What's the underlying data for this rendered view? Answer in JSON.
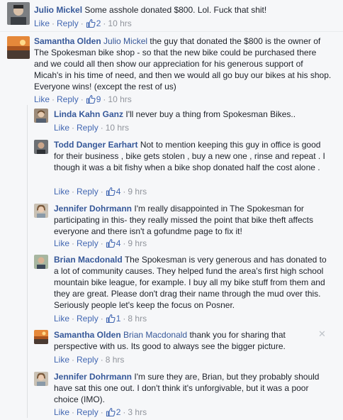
{
  "comments": [
    {
      "author": "Julio Mickel",
      "mention": "",
      "text": "Some asshole donated $800. Lol. Fuck that shit!",
      "like_label": "Like",
      "reply_label": "Reply",
      "likes": "2",
      "time": "10 hrs"
    },
    {
      "author": "Samantha Olden",
      "mention": "Julio Mickel",
      "text": "the guy that donated the $800 is the owner of The Spokesman bike shop - so that the new bike could be purchased there and we could all then show our appreciation for his generous support of Micah's in his time of need, and then we would all go buy our bikes at his shop. Everyone wins! (except the rest of us)",
      "like_label": "Like",
      "reply_label": "Reply",
      "likes": "9",
      "time": "10 hrs"
    },
    {
      "author": "Linda Kahn Ganz",
      "mention": "",
      "text": "I'll never buy a thing from Spokesman Bikes..",
      "like_label": "Like",
      "reply_label": "Reply",
      "likes": "",
      "time": "10 hrs"
    },
    {
      "author": "Todd Danger Earhart",
      "mention": "",
      "text": "Not to mention keeping this guy in office is good for their business , bike gets stolen , buy a new one , rinse and repeat . I though it was a bit fishy when a bike shop donated half the cost alone .",
      "like_label": "Like",
      "reply_label": "Reply",
      "likes": "4",
      "time": "9 hrs"
    },
    {
      "author": "Jennifer Dohrmann",
      "mention": "",
      "text": "I'm really disappointed in The Spokesman for participating in this- they really missed the point that bike theft affects everyone and there isn't a gofundme page to fix it!",
      "like_label": "Like",
      "reply_label": "Reply",
      "likes": "4",
      "time": "9 hrs"
    },
    {
      "author": "Brian Macdonald",
      "mention": "",
      "text": "The Spokesman is very generous and has donated to a lot of community causes. They helped fund the area's first high school mountain bike league, for example. I buy all my bike stuff from them and they are great. Please don't drag their name through the mud over this. Seriously people let's keep the focus on Posner.",
      "like_label": "Like",
      "reply_label": "Reply",
      "likes": "1",
      "time": "8 hrs"
    },
    {
      "author": "Samantha Olden",
      "mention": "Brian Macdonald",
      "text": "thank you for sharing that perspective with us. Its good to always see the bigger picture.",
      "like_label": "Like",
      "reply_label": "Reply",
      "likes": "",
      "time": "8 hrs"
    },
    {
      "author": "Jennifer Dohrmann",
      "mention": "",
      "text": "I'm sure they are, Brian, but they probably should have sat this one out. I don't think it's unforgivable, but it was a poor choice (IMO).",
      "like_label": "Like",
      "reply_label": "Reply",
      "likes": "2",
      "time": "3 hrs"
    }
  ],
  "colors": {
    "link": "#365899",
    "action": "#4267b2",
    "meta": "#90949c",
    "background": "#f6f7f9"
  },
  "icons": {
    "like_count": "thumbs-up-icon",
    "close": "close-icon"
  }
}
